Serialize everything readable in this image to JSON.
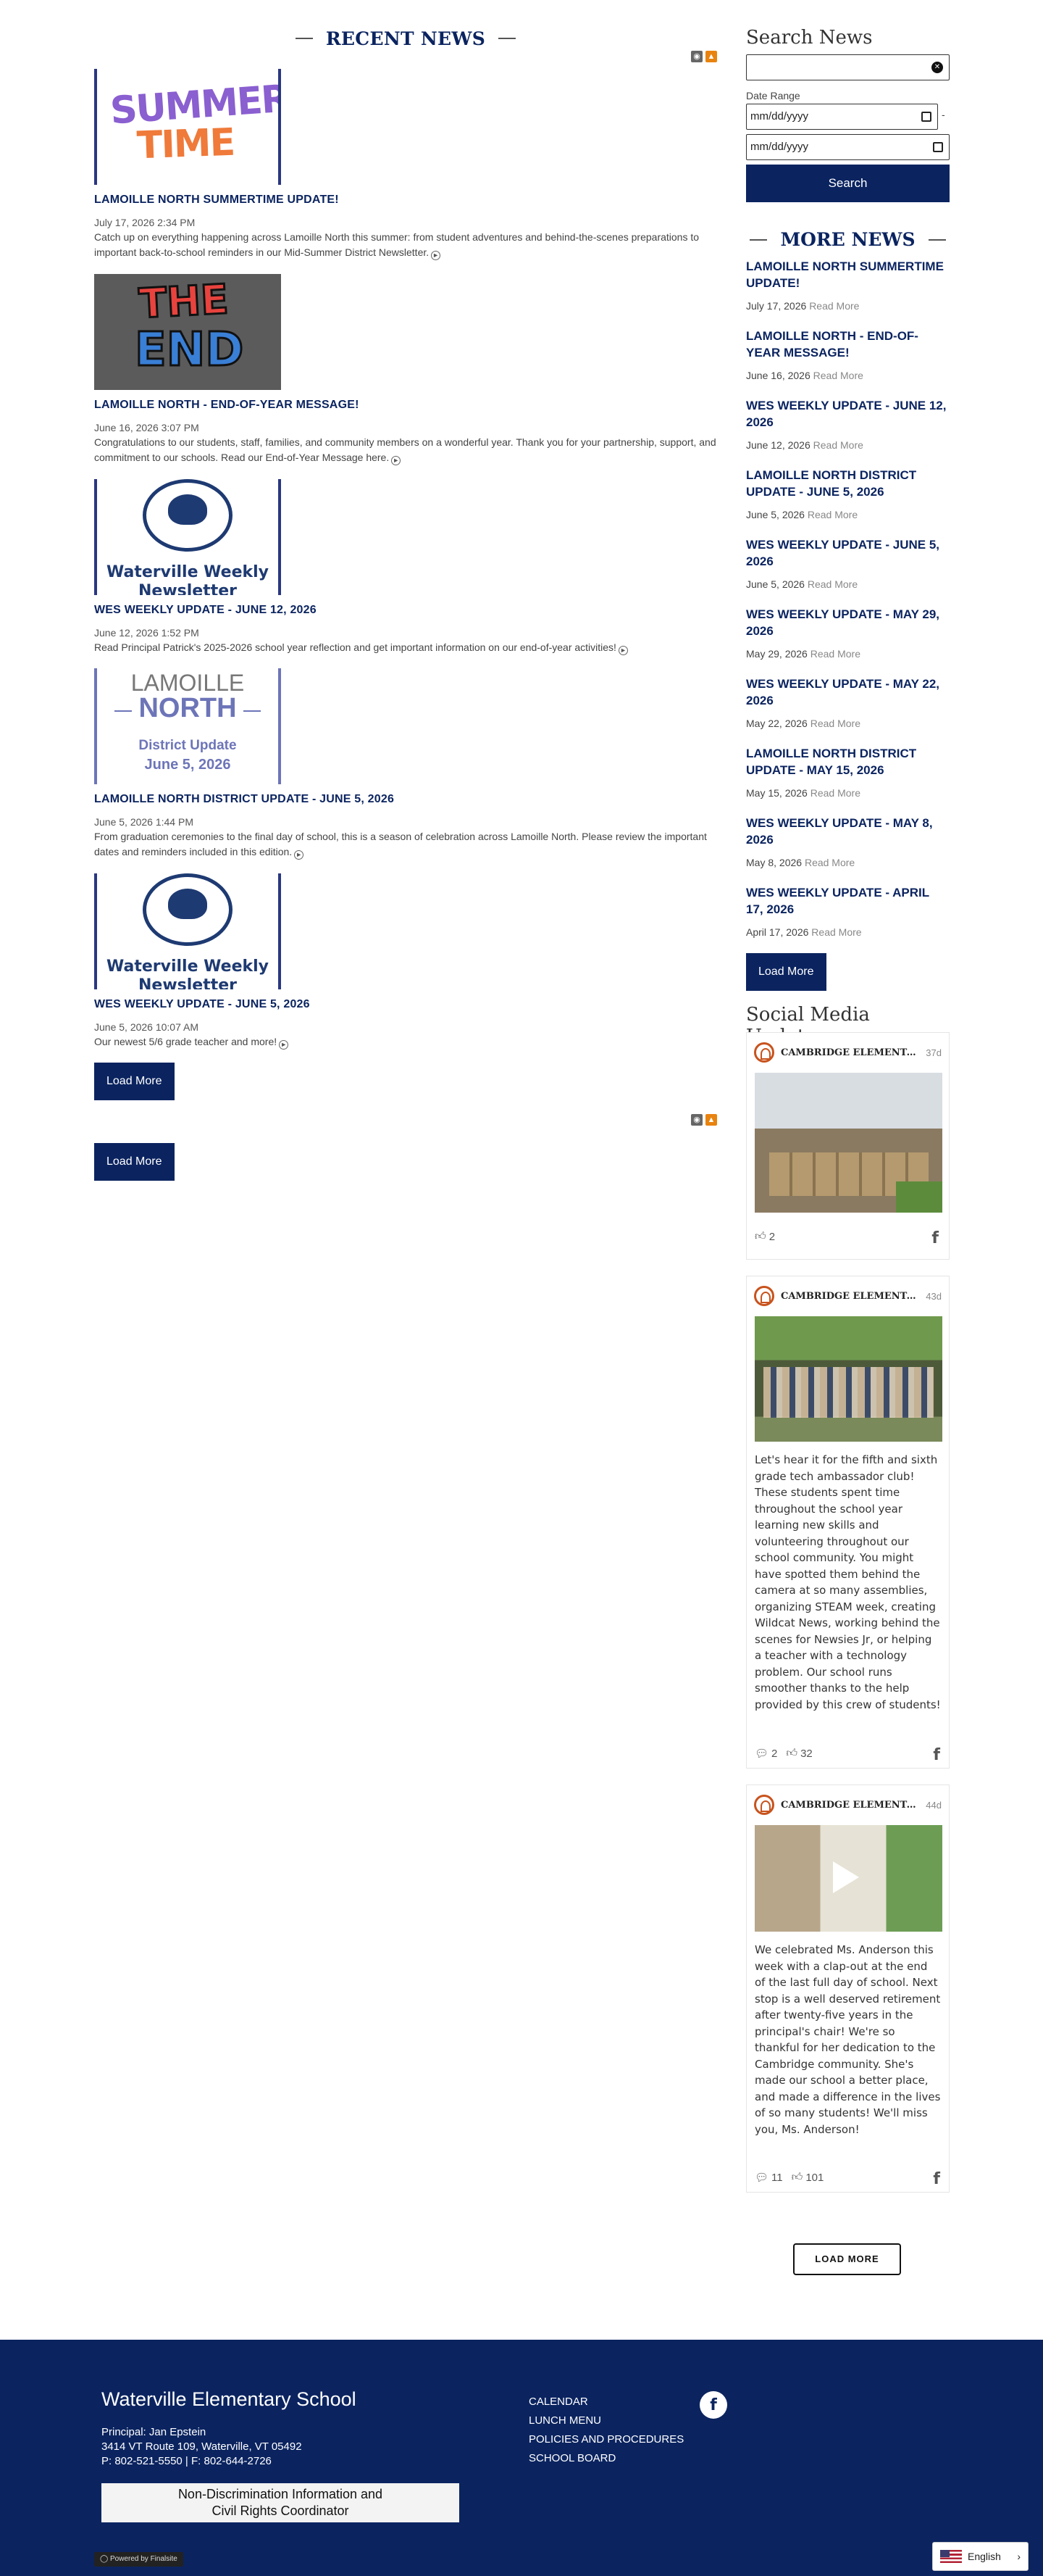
{
  "news": {
    "heading": "RECENT NEWS",
    "posts": [
      {
        "title": "LAMOILLE NORTH SUMMERTIME UPDATE!",
        "date": "July 17, 2026 2:34 PM",
        "summary": "Catch up on everything happening across Lamoille North this summer: from student adventures and behind-the-scenes preparations to important back-to-school reminders in our Mid-Summer District Newsletter.",
        "image_text_1": "SUMMER",
        "image_text_2": "TIME"
      },
      {
        "title": "LAMOILLE NORTH - END-OF-YEAR MESSAGE!",
        "date": "June 16, 2026 3:07 PM",
        "summary": "Congratulations to our students, staff, families, and community members on a wonderful year. Thank you for your partnership, support, and commitment to our schools. Read our End-of-Year Message here.",
        "image_text_1": "THE",
        "image_text_2": "END"
      },
      {
        "title": "WES WEEKLY UPDATE - JUNE 12, 2026",
        "date": "June 12, 2026 1:52 PM",
        "summary": "Read Principal Patrick's 2025-2026 school year reflection and get important information on our end-of-year activities!",
        "image_text_1": "Waterville Weekly",
        "image_text_2": "Newsletter"
      },
      {
        "title": "LAMOILLE NORTH DISTRICT UPDATE - JUNE 5, 2026",
        "date": "June 5, 2026 1:44 PM",
        "summary": "From graduation ceremonies to the final day of school, this is a season of celebration across Lamoille North. Please review the important dates and reminders included in this edition.",
        "image_text_1": "LAMOILLE",
        "image_text_2": "NORTH",
        "image_text_3": "District Update",
        "image_text_4": "June 5, 2026"
      },
      {
        "title": "WES WEEKLY UPDATE - JUNE 5, 2026",
        "date": "June 5, 2026 10:07 AM",
        "summary": "Our newest 5/6 grade teacher and more!",
        "image_text_1": "Waterville Weekly",
        "image_text_2": "Newsletter"
      }
    ],
    "load_more_label": "Load More",
    "load_more_label_2": "Load More"
  },
  "search": {
    "heading": "Search News",
    "date_range_label": "Date Range",
    "date_placeholder": "mm/dd/yyyy",
    "dash": "-",
    "button_label": "Search"
  },
  "more_news": {
    "heading": "MORE NEWS",
    "read_more": "Read More",
    "items": [
      {
        "title": "LAMOILLE NORTH SUMMERTIME UPDATE!",
        "date": "July 17, 2026"
      },
      {
        "title": "LAMOILLE NORTH - END-OF-YEAR MESSAGE!",
        "date": "June 16, 2026"
      },
      {
        "title": "WES WEEKLY UPDATE - JUNE 12, 2026",
        "date": "June 12, 2026"
      },
      {
        "title": "LAMOILLE NORTH DISTRICT UPDATE - JUNE 5, 2026",
        "date": "June 5, 2026"
      },
      {
        "title": "WES WEEKLY UPDATE - JUNE 5, 2026",
        "date": "June 5, 2026"
      },
      {
        "title": "WES WEEKLY UPDATE - MAY 29, 2026",
        "date": "May 29, 2026"
      },
      {
        "title": "WES WEEKLY UPDATE - MAY 22, 2026",
        "date": "May 22, 2026"
      },
      {
        "title": "LAMOILLE NORTH DISTRICT UPDATE - MAY 15, 2026",
        "date": "May 15, 2026"
      },
      {
        "title": "WES WEEKLY UPDATE - MAY 8, 2026",
        "date": "May 8, 2026"
      },
      {
        "title": "WES WEEKLY UPDATE - APRIL 17, 2026",
        "date": "April 17, 2026"
      }
    ],
    "load_more_label": "Load More"
  },
  "social": {
    "heading": "Social Media Updates",
    "posts": [
      {
        "account": "CAMBRIDGE ELEMENTARY SCHOOL",
        "age": "37d",
        "text": "",
        "comments": "",
        "likes": "2"
      },
      {
        "account": "CAMBRIDGE ELEMENTARY SCHOOL",
        "age": "43d",
        "text": "Let's hear it for the fifth and sixth grade tech ambassador club! These students spent time throughout the school year learning new skills and volunteering throughout our school community. You might have spotted them behind the camera at so many assemblies, organizing STEAM week, creating Wildcat News, working behind the scenes for Newsies Jr, or helping a teacher with a technology problem. Our school runs smoother thanks to the help provided by this crew of students!",
        "comments": "2",
        "likes": "32"
      },
      {
        "account": "CAMBRIDGE ELEMENTARY SCHOOL",
        "age": "44d",
        "text": "We celebrated Ms. Anderson this week with a clap-out at the end of the last full day of school. Next stop is a well deserved retirement after twenty-five years in the principal's chair! We're so thankful for her dedication to the Cambridge community. She's made our school a better place, and made a difference in the lives of so many students! We'll miss you, Ms. Anderson!",
        "comments": "11",
        "likes": "101"
      }
    ],
    "load_more_label": "LOAD MORE"
  },
  "footer": {
    "school_name": "Waterville Elementary School",
    "principal": "Principal: Jan Epstein",
    "address": "3414 VT Route 109, Waterville, VT 05492",
    "phone": "P: 802-521-5550 | F: 802-644-2726",
    "nondiscrimination_line1": "Non-Discrimination Information and",
    "nondiscrimination_line2": "Civil Rights Coordinator",
    "links": [
      "CALENDAR",
      "LUNCH MENU",
      "POLICIES AND PROCEDURES",
      "SCHOOL BOARD"
    ],
    "powered_by": "Powered by Finalsite"
  },
  "language": {
    "selected": "English"
  },
  "colors": {
    "navy": "#0b2460",
    "accent_orange": "#c8531d",
    "feed_orange": "#e8830f"
  }
}
